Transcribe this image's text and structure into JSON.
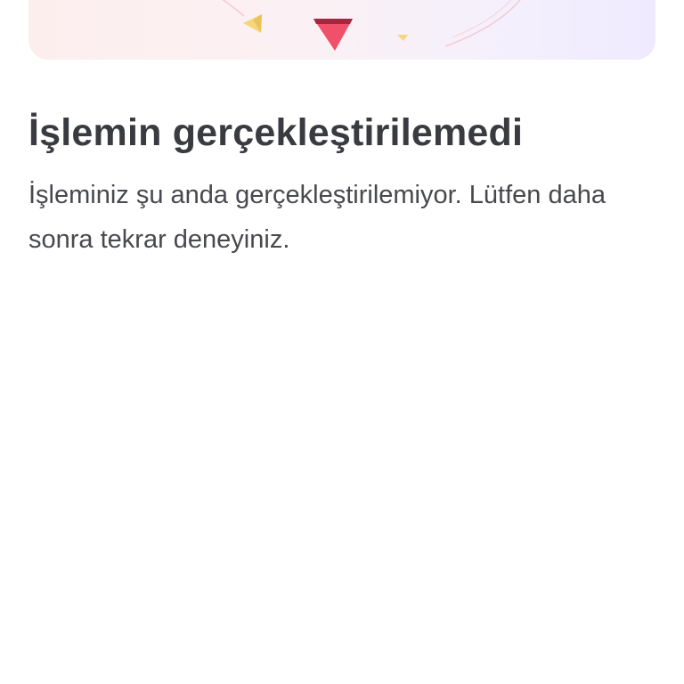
{
  "illustration": {
    "icon": "error-illustration",
    "colors": {
      "background_start": "#fdeeee",
      "background_end": "#efeafe",
      "triangle_main": "#f0506a",
      "triangle_accent": "#f5d77a",
      "line_color": "#f4c9d3"
    }
  },
  "error": {
    "title": "İşlemin gerçekleştirilemedi",
    "message": "İşleminiz şu anda gerçekleştirilemiyor. Lütfen daha sonra tekrar deneyiniz."
  }
}
